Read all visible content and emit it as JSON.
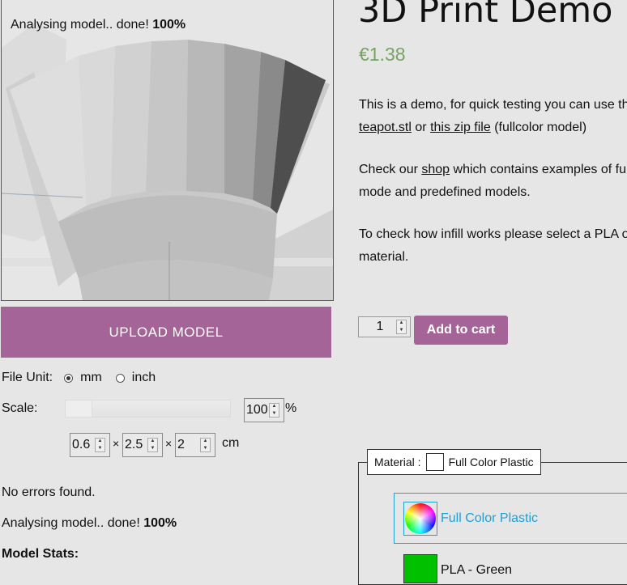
{
  "viewer": {
    "status_prefix": "Analysing model.. done!",
    "status_percent": "100%"
  },
  "upload": {
    "label": "UPLOAD MODEL"
  },
  "file_unit": {
    "label": "File Unit:",
    "options": [
      {
        "label": "mm",
        "checked": true
      },
      {
        "label": "inch",
        "checked": false
      }
    ]
  },
  "scale": {
    "label": "Scale:",
    "value": "100",
    "unit": "%"
  },
  "dimensions": {
    "x": "0.6",
    "y": "2.5",
    "z": "2",
    "separator": "×",
    "unit": "cm"
  },
  "messages": {
    "errors": "No errors found.",
    "analysis_prefix": "Analysing model.. done!",
    "analysis_percent": "100%",
    "stats_heading": "Model Stats:"
  },
  "product": {
    "title": "3D Print Demo",
    "price": "€1.38",
    "p1_line1": "This is a demo, for quick testing you can use th",
    "p1_link1": "teapot.stl",
    "p1_or": " or ",
    "p1_link2": "this zip file",
    "p1_tail": " (fullcolor model)",
    "p2_prefix": "Check our ",
    "p2_link": "shop",
    "p2_tail": " which contains examples of ful",
    "p2_line2": "mode and predefined models.",
    "p3_line1": "To check how infill works please select a PLA o",
    "p3_line2": "material."
  },
  "cart": {
    "quantity": "1",
    "add_label": "Add to cart"
  },
  "material": {
    "legend_label": "Material :",
    "legend_value": "Full Color Plastic",
    "options": [
      {
        "label": "Full Color Plastic",
        "selected": true
      },
      {
        "label": "PLA - Green",
        "selected": false,
        "color": "#00c000"
      }
    ]
  },
  "colors": {
    "accent": "#a46497",
    "price": "#77a464",
    "selection": "#1fa0d5"
  }
}
